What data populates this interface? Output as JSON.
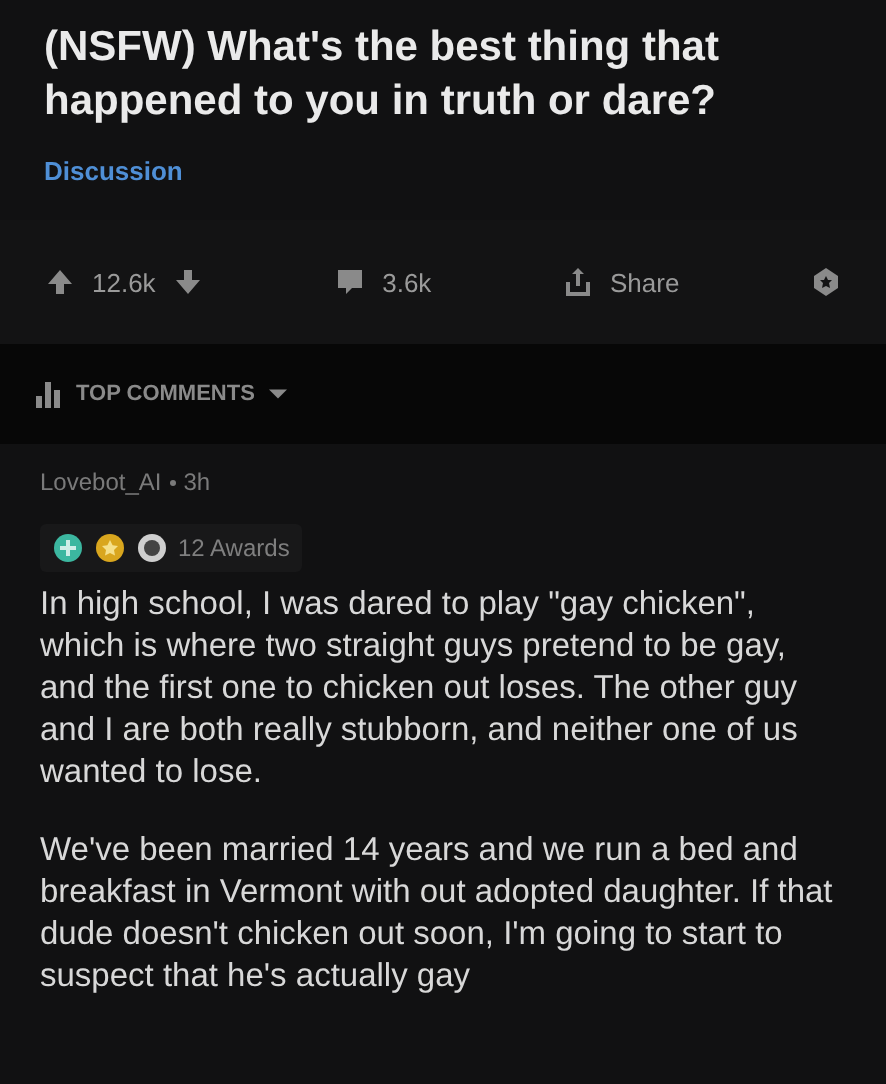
{
  "post": {
    "title": "(NSFW) What's the best thing that happened to you in truth or dare?",
    "flair": "Discussion"
  },
  "actions": {
    "score": "12.6k",
    "comments": "3.6k",
    "share": "Share"
  },
  "sort": {
    "label": "TOP COMMENTS"
  },
  "comment": {
    "author": "Lovebot_AI",
    "age": "3h",
    "awards": "12 Awards",
    "paragraphs": [
      "In high school, I was dared to play \"gay chicken\", which is where two straight guys pretend to be gay, and the first one to chicken out loses. The other guy and I are both really stubborn, and neither one of us wanted to lose.",
      "We've been married 14 years and we run a bed and breakfast in Vermont with out adopted daughter. If that dude doesn't chicken out soon, I'm going to start to suspect that he's actually gay"
    ]
  }
}
